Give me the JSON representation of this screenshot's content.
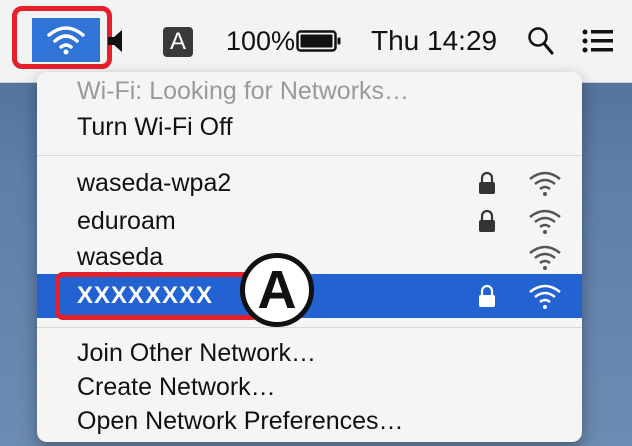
{
  "menubar": {
    "input_source": "A",
    "battery_percent": "100%",
    "clock": "Thu 14:29"
  },
  "menu": {
    "status": "Wi-Fi: Looking for Networks…",
    "toggle": "Turn Wi-Fi Off",
    "networks": [
      {
        "name": "waseda-wpa2",
        "locked": true,
        "selected": false
      },
      {
        "name": "eduroam",
        "locked": true,
        "selected": false
      },
      {
        "name": "waseda",
        "locked": false,
        "selected": false
      },
      {
        "name": "XXXXXXXX",
        "locked": true,
        "selected": true
      }
    ],
    "join_other": "Join Other Network…",
    "create": "Create Network…",
    "open_prefs": "Open Network Preferences…"
  },
  "annotation": {
    "badge_label": "A"
  },
  "colors": {
    "selection": "#2363d1",
    "highlight": "#e5202a"
  }
}
